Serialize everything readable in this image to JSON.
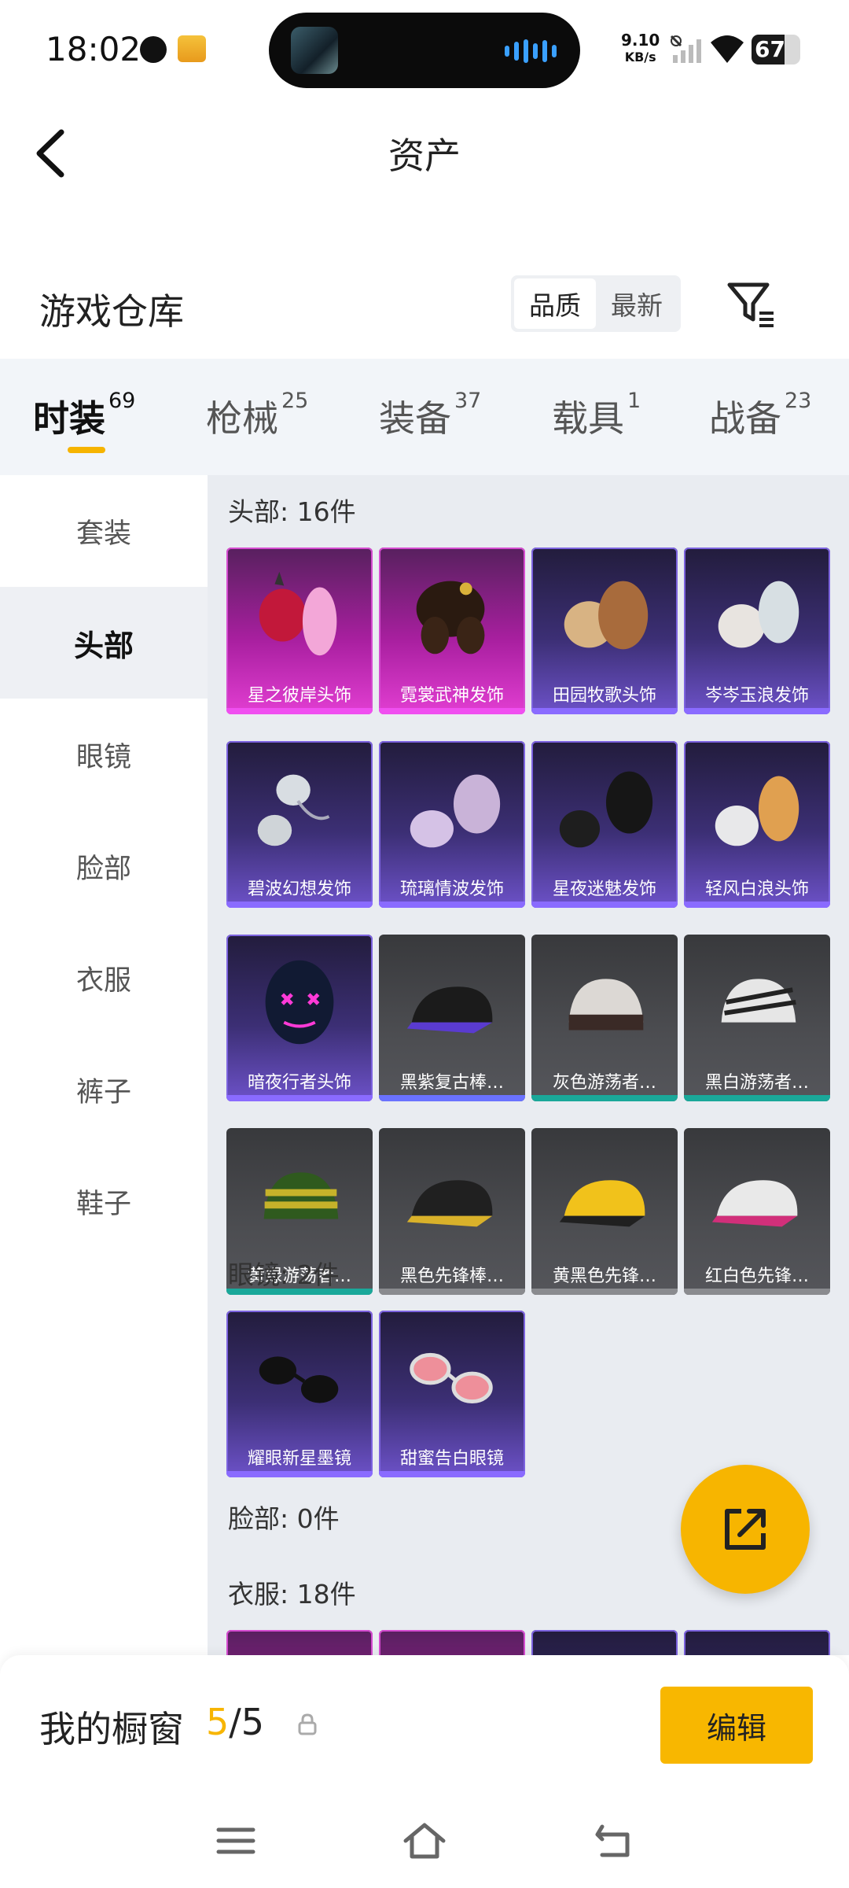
{
  "status_bar": {
    "time": "18:02",
    "net_speed_value": "9.10",
    "net_speed_unit": "KB/s",
    "battery": "67",
    "battery_level": 0.67
  },
  "header": {
    "title": "资产"
  },
  "warehouse": {
    "title": "游戏仓库",
    "sort_options": [
      "品质",
      "最新"
    ],
    "active_sort": "品质"
  },
  "tabs": [
    {
      "label": "时装",
      "count": "69",
      "active": true
    },
    {
      "label": "枪械",
      "count": "25",
      "active": false
    },
    {
      "label": "装备",
      "count": "37",
      "active": false
    },
    {
      "label": "载具",
      "count": "1",
      "active": false
    },
    {
      "label": "战备",
      "count": "23",
      "active": false
    }
  ],
  "sidebar": {
    "items": [
      {
        "label": "套装",
        "active": false
      },
      {
        "label": "头部",
        "active": true
      },
      {
        "label": "眼镜",
        "active": false
      },
      {
        "label": "脸部",
        "active": false
      },
      {
        "label": "衣服",
        "active": false
      },
      {
        "label": "裤子",
        "active": false
      },
      {
        "label": "鞋子",
        "active": false
      }
    ]
  },
  "sections": {
    "head": {
      "title": "头部: 16件",
      "items": [
        {
          "name": "星之彼岸头饰",
          "rarity": "pink"
        },
        {
          "name": "霓裳武神发饰",
          "rarity": "pink"
        },
        {
          "name": "田园牧歌头饰",
          "rarity": "purple"
        },
        {
          "name": "岑岑玉浪发饰",
          "rarity": "purple"
        },
        {
          "name": "碧波幻想发饰",
          "rarity": "purple"
        },
        {
          "name": "琉璃情波发饰",
          "rarity": "purple"
        },
        {
          "name": "星夜迷魅发饰",
          "rarity": "purple"
        },
        {
          "name": "轻风白浪头饰",
          "rarity": "purple"
        },
        {
          "name": "暗夜行者头饰",
          "rarity": "purple"
        },
        {
          "name": "黑紫复古棒…",
          "rarity": "blue"
        },
        {
          "name": "灰色游荡者…",
          "rarity": "teal"
        },
        {
          "name": "黑白游荡者…",
          "rarity": "teal"
        },
        {
          "name": "黄绿游荡者…",
          "rarity": "teal"
        },
        {
          "name": "黑色先锋棒…",
          "rarity": "grey"
        },
        {
          "name": "黄黑色先锋…",
          "rarity": "grey"
        },
        {
          "name": "红白色先锋…",
          "rarity": "grey"
        }
      ]
    },
    "glasses": {
      "title": "眼镜: 2件",
      "items": [
        {
          "name": "耀眼新星墨镜",
          "rarity": "purple"
        },
        {
          "name": "甜蜜告白眼镜",
          "rarity": "purple"
        }
      ]
    },
    "face": {
      "title": "脸部: 0件"
    },
    "clothes": {
      "title": "衣服: 18件"
    }
  },
  "showcase": {
    "title": "我的橱窗",
    "used": "5",
    "separator": "/",
    "total": "5",
    "edit_label": "编辑"
  },
  "colors": {
    "accent": "#f7b500",
    "legendary_pink": "#e23ed2",
    "epic_purple": "#6d52c9",
    "common_grey": "#4c4d51"
  }
}
